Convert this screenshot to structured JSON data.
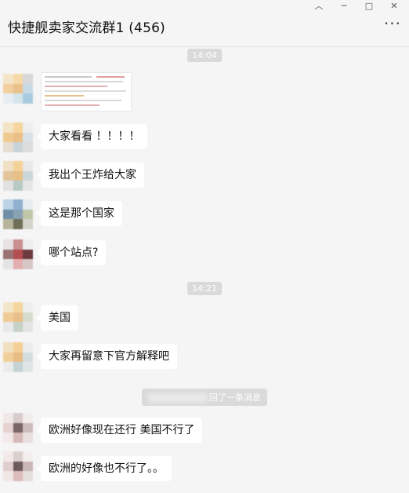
{
  "header": {
    "title": "快捷舰卖家交流群1 (456)",
    "more_label": "···"
  },
  "window_controls": [
    "︿",
    "─",
    "□",
    "✕"
  ],
  "timestamps": [
    "14:04",
    "14:21"
  ],
  "messages": [
    {
      "type": "image"
    },
    {
      "type": "text",
      "text": "大家看看 ！！！！"
    },
    {
      "type": "text",
      "text": "我出个王炸给大家"
    },
    {
      "type": "text",
      "text": "这是那个国家"
    },
    {
      "type": "text",
      "text": "哪个站点?"
    },
    {
      "type": "text",
      "text": "美国"
    },
    {
      "type": "text",
      "text": "大家再留意下官方解释吧"
    },
    {
      "type": "text",
      "text": "欧洲好像现在还行 美国不行了"
    },
    {
      "type": "text",
      "text": "欧洲的好像也不行了。。"
    }
  ],
  "recall_notice": "回了一条消息",
  "colors": {
    "background": "#f5f5f5",
    "bubble": "#ffffff",
    "timestamp_bg": "#dadada"
  }
}
